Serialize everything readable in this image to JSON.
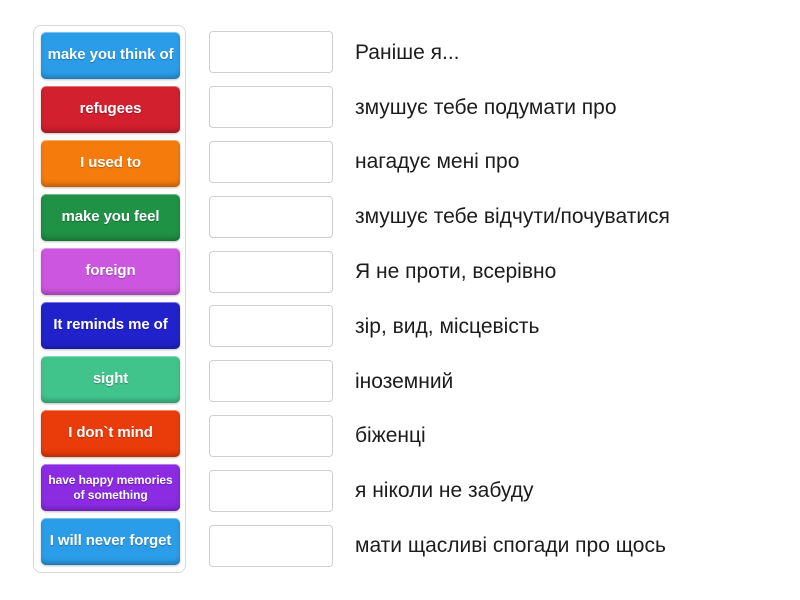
{
  "activity": {
    "type": "match-up",
    "tray": {
      "tiles": [
        {
          "label": "make you think of",
          "color": "#2b9de8",
          "lines": 2,
          "small": false
        },
        {
          "label": "refugees",
          "color": "#d2202f",
          "lines": 1,
          "small": false
        },
        {
          "label": "I used to",
          "color": "#f57c0c",
          "lines": 1,
          "small": false
        },
        {
          "label": "make you feel",
          "color": "#1f9246",
          "lines": 2,
          "small": false
        },
        {
          "label": "foreign",
          "color": "#cc56e0",
          "lines": 1,
          "small": false
        },
        {
          "label": "It reminds me of",
          "color": "#2222cc",
          "lines": 2,
          "small": false
        },
        {
          "label": "sight",
          "color": "#41c48c",
          "lines": 1,
          "small": false
        },
        {
          "label": "I don`t mind",
          "color": "#ea3c0a",
          "lines": 1,
          "small": false
        },
        {
          "label": "have happy memories of something",
          "color": "#8b2be2",
          "lines": 3,
          "small": true
        },
        {
          "label": "I will never forget",
          "color": "#2b9de8",
          "lines": 2,
          "small": false
        }
      ]
    },
    "answers": [
      {
        "drop_value": "",
        "text": "Раніше я..."
      },
      {
        "drop_value": "",
        "text": "змушує тебе подумати про"
      },
      {
        "drop_value": "",
        "text": "нагадує мені про"
      },
      {
        "drop_value": "",
        "text": "змушує тебе відчути/почуватися"
      },
      {
        "drop_value": "",
        "text": "Я не проти, всерівно"
      },
      {
        "drop_value": "",
        "text": "зір, вид, місцевість"
      },
      {
        "drop_value": "",
        "text": "іноземний"
      },
      {
        "drop_value": "",
        "text": "біженці"
      },
      {
        "drop_value": "",
        "text": "я ніколи не забуду"
      },
      {
        "drop_value": "",
        "text": "мати щасливі спогади про щось"
      }
    ],
    "colors": {
      "tray_border": "#d8d8d8",
      "drop_zone_border": "#cfcfcf",
      "text": "#1c1c1c",
      "background": "#ffffff"
    }
  }
}
